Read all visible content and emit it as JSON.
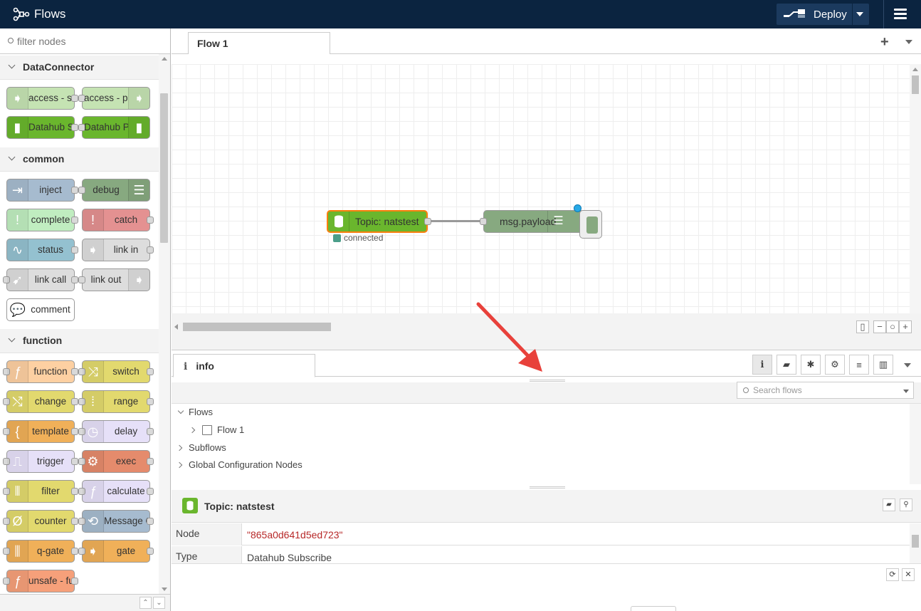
{
  "header": {
    "title": "Flows",
    "deploy_label": "Deploy"
  },
  "palette": {
    "search_placeholder": "filter nodes",
    "categories": [
      {
        "label": "DataConnector"
      },
      {
        "label": "common"
      },
      {
        "label": "function"
      }
    ],
    "nodes": {
      "access_sub": "access -\nsubscribe",
      "access_pub": "access -\npublish",
      "datahub_sub": "Datahub\nSubscribe",
      "datahub_pub": "Datahub\nPublish",
      "inject": "inject",
      "debug": "debug",
      "complete": "complete",
      "catch": "catch",
      "status": "status",
      "link_in": "link in",
      "link_call": "link call",
      "link_out": "link out",
      "comment": "comment",
      "function": "function",
      "switch": "switch",
      "change": "change",
      "range": "range",
      "template": "template",
      "delay": "delay",
      "trigger": "trigger",
      "exec": "exec",
      "filter": "filter",
      "calculate": "calculate",
      "counter": "counter",
      "message": "Message\nCounter",
      "qgate": "q-gate",
      "gate": "gate",
      "unsafe": "unsafe -\nfunction"
    }
  },
  "workspace": {
    "tab_label": "Flow 1",
    "nodes": {
      "topic": "Topic: natstest",
      "topic_status": "connected",
      "payload": "msg.payload"
    }
  },
  "sidebar": {
    "tab_label": "info",
    "search_placeholder": "Search flows",
    "tree": {
      "flows": "Flows",
      "flow1": "Flow 1",
      "subflows": "Subflows",
      "global_config": "Global Configuration Nodes"
    },
    "node_info": {
      "title": "Topic: natstest",
      "rows": [
        {
          "key": "Node",
          "value": "\"865a0d641d5ed723\""
        },
        {
          "key": "Type",
          "value": "Datahub Subscribe"
        }
      ]
    }
  },
  "colors": {
    "header_bg": "#0b2440",
    "arrow": "#e8413b",
    "datahub_green": "#6ab62d"
  }
}
